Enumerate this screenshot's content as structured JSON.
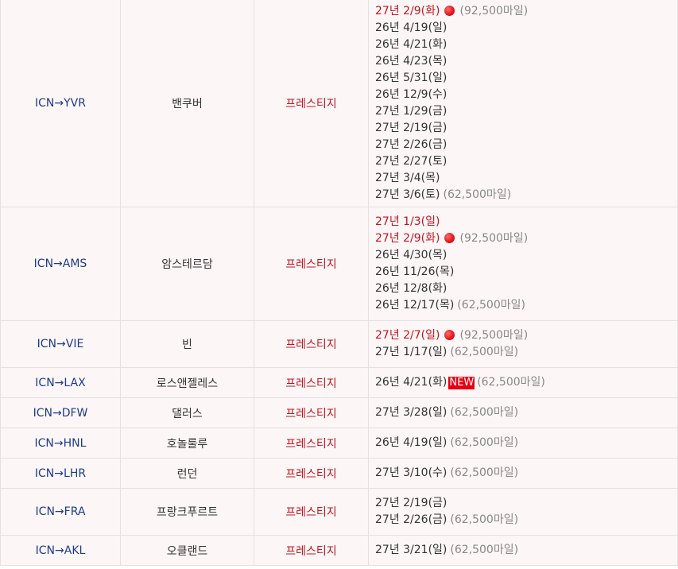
{
  "rows": [
    {
      "route": "ICN→YVR",
      "city": "밴쿠버",
      "cls": "프레스티지",
      "dates": [
        {
          "text": "27년 2/9(화)",
          "red": true,
          "dot": true,
          "miles": "(92,500마일)"
        },
        {
          "text": "26년 4/19(일)"
        },
        {
          "text": "26년 4/21(화)"
        },
        {
          "text": "26년 4/23(목)"
        },
        {
          "text": "26년 5/31(일)"
        },
        {
          "text": "26년 12/9(수)"
        },
        {
          "text": "27년 1/29(금)"
        },
        {
          "text": "27년 2/19(금)"
        },
        {
          "text": "27년 2/26(금)"
        },
        {
          "text": "27년 2/27(토)"
        },
        {
          "text": "27년 3/4(목)"
        },
        {
          "text": "27년 3/6(토)",
          "miles": "(62,500마일)"
        }
      ]
    },
    {
      "route": "ICN→AMS",
      "city": "암스테르담",
      "cls": "프레스티지",
      "dates": [
        {
          "text": "27년 1/3(일)",
          "red": true
        },
        {
          "text": "27년 2/9(화)",
          "red": true,
          "dot": true,
          "miles": "(92,500마일)"
        },
        {
          "text": "26년 4/30(목)"
        },
        {
          "text": "26년 11/26(목)"
        },
        {
          "text": "26년 12/8(화)"
        },
        {
          "text": "26년 12/17(목)",
          "miles": "(62,500마일)"
        }
      ]
    },
    {
      "route": "ICN→VIE",
      "city": "빈",
      "cls": "프레스티지",
      "dates": [
        {
          "text": "27년 2/7(일)",
          "red": true,
          "dot": true,
          "miles": "(92,500마일)"
        },
        {
          "text": "27년 1/17(일)",
          "miles": "(62,500마일)"
        }
      ]
    },
    {
      "route": "ICN→LAX",
      "city": "로스앤젤레스",
      "cls": "프레스티지",
      "dates": [
        {
          "text": "26년 4/21(화)",
          "badge": "NEW",
          "miles": "(62,500마일)"
        }
      ]
    },
    {
      "route": "ICN→DFW",
      "city": "댈러스",
      "cls": "프레스티지",
      "dates": [
        {
          "text": "27년 3/28(일)",
          "miles": "(62,500마일)"
        }
      ]
    },
    {
      "route": "ICN→HNL",
      "city": "호놀룰루",
      "cls": "프레스티지",
      "dates": [
        {
          "text": "26년 4/19(일)",
          "miles": "(62,500마일)"
        }
      ]
    },
    {
      "route": "ICN→LHR",
      "city": "런던",
      "cls": "프레스티지",
      "dates": [
        {
          "text": "27년 3/10(수)",
          "miles": "(62,500마일)"
        }
      ]
    },
    {
      "route": "ICN→FRA",
      "city": "프랑크푸르트",
      "cls": "프레스티지",
      "dates": [
        {
          "text": "27년 2/19(금)"
        },
        {
          "text": "27년 2/26(금)",
          "miles": "(62,500마일)"
        }
      ]
    },
    {
      "route": "ICN→AKL",
      "city": "오클랜드",
      "cls": "프레스티지",
      "dates": [
        {
          "text": "27년 3/21(일)",
          "miles": "(62,500마일)"
        }
      ]
    }
  ]
}
